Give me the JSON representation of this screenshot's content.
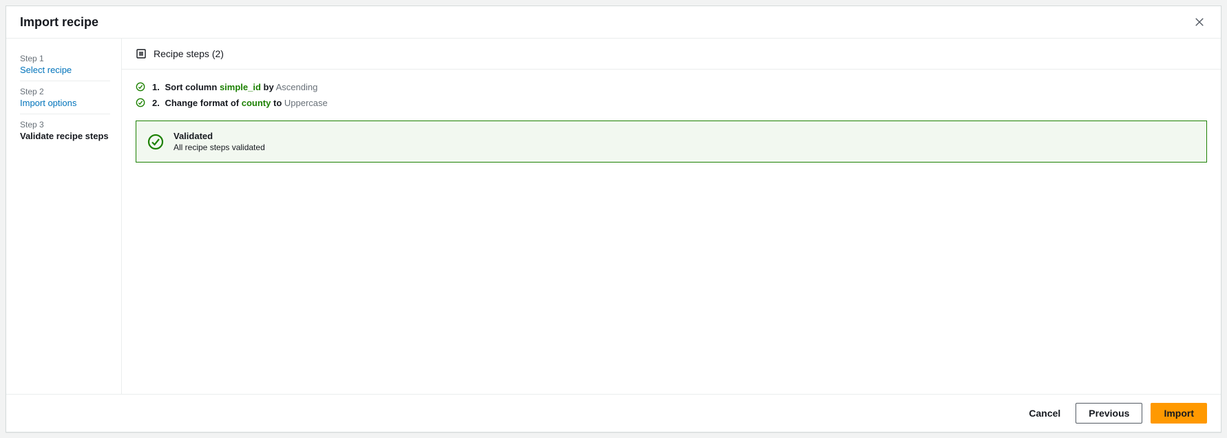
{
  "header": {
    "title": "Import recipe"
  },
  "sidebar": {
    "steps": [
      {
        "num": "Step 1",
        "label": "Select recipe",
        "link": true
      },
      {
        "num": "Step 2",
        "label": "Import options",
        "link": true
      },
      {
        "num": "Step 3",
        "label": "Validate recipe steps",
        "link": false
      }
    ]
  },
  "main": {
    "section_title": "Recipe steps (2)",
    "steps": [
      {
        "num": "1.",
        "action": "Sort column",
        "col": "simple_id",
        "joiner": "by",
        "value": "Ascending"
      },
      {
        "num": "2.",
        "action": "Change format",
        "pre": "of",
        "col": "county",
        "joiner": "to",
        "value": "Uppercase"
      }
    ],
    "validated": {
      "title": "Validated",
      "subtitle": "All recipe steps validated"
    }
  },
  "footer": {
    "cancel": "Cancel",
    "previous": "Previous",
    "import": "Import"
  }
}
